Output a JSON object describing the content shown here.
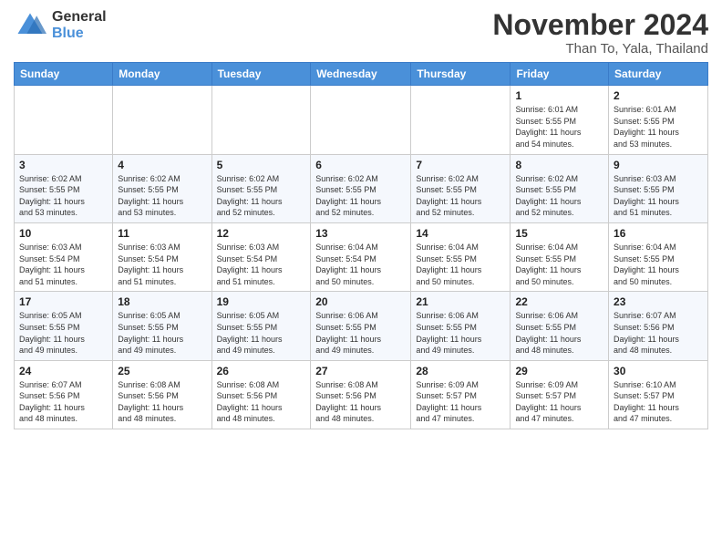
{
  "header": {
    "logo_general": "General",
    "logo_blue": "Blue",
    "month_title": "November 2024",
    "location": "Than To, Yala, Thailand"
  },
  "days_of_week": [
    "Sunday",
    "Monday",
    "Tuesday",
    "Wednesday",
    "Thursday",
    "Friday",
    "Saturday"
  ],
  "weeks": [
    [
      {
        "day": "",
        "info": ""
      },
      {
        "day": "",
        "info": ""
      },
      {
        "day": "",
        "info": ""
      },
      {
        "day": "",
        "info": ""
      },
      {
        "day": "",
        "info": ""
      },
      {
        "day": "1",
        "info": "Sunrise: 6:01 AM\nSunset: 5:55 PM\nDaylight: 11 hours\nand 54 minutes."
      },
      {
        "day": "2",
        "info": "Sunrise: 6:01 AM\nSunset: 5:55 PM\nDaylight: 11 hours\nand 53 minutes."
      }
    ],
    [
      {
        "day": "3",
        "info": "Sunrise: 6:02 AM\nSunset: 5:55 PM\nDaylight: 11 hours\nand 53 minutes."
      },
      {
        "day": "4",
        "info": "Sunrise: 6:02 AM\nSunset: 5:55 PM\nDaylight: 11 hours\nand 53 minutes."
      },
      {
        "day": "5",
        "info": "Sunrise: 6:02 AM\nSunset: 5:55 PM\nDaylight: 11 hours\nand 52 minutes."
      },
      {
        "day": "6",
        "info": "Sunrise: 6:02 AM\nSunset: 5:55 PM\nDaylight: 11 hours\nand 52 minutes."
      },
      {
        "day": "7",
        "info": "Sunrise: 6:02 AM\nSunset: 5:55 PM\nDaylight: 11 hours\nand 52 minutes."
      },
      {
        "day": "8",
        "info": "Sunrise: 6:02 AM\nSunset: 5:55 PM\nDaylight: 11 hours\nand 52 minutes."
      },
      {
        "day": "9",
        "info": "Sunrise: 6:03 AM\nSunset: 5:55 PM\nDaylight: 11 hours\nand 51 minutes."
      }
    ],
    [
      {
        "day": "10",
        "info": "Sunrise: 6:03 AM\nSunset: 5:54 PM\nDaylight: 11 hours\nand 51 minutes."
      },
      {
        "day": "11",
        "info": "Sunrise: 6:03 AM\nSunset: 5:54 PM\nDaylight: 11 hours\nand 51 minutes."
      },
      {
        "day": "12",
        "info": "Sunrise: 6:03 AM\nSunset: 5:54 PM\nDaylight: 11 hours\nand 51 minutes."
      },
      {
        "day": "13",
        "info": "Sunrise: 6:04 AM\nSunset: 5:54 PM\nDaylight: 11 hours\nand 50 minutes."
      },
      {
        "day": "14",
        "info": "Sunrise: 6:04 AM\nSunset: 5:55 PM\nDaylight: 11 hours\nand 50 minutes."
      },
      {
        "day": "15",
        "info": "Sunrise: 6:04 AM\nSunset: 5:55 PM\nDaylight: 11 hours\nand 50 minutes."
      },
      {
        "day": "16",
        "info": "Sunrise: 6:04 AM\nSunset: 5:55 PM\nDaylight: 11 hours\nand 50 minutes."
      }
    ],
    [
      {
        "day": "17",
        "info": "Sunrise: 6:05 AM\nSunset: 5:55 PM\nDaylight: 11 hours\nand 49 minutes."
      },
      {
        "day": "18",
        "info": "Sunrise: 6:05 AM\nSunset: 5:55 PM\nDaylight: 11 hours\nand 49 minutes."
      },
      {
        "day": "19",
        "info": "Sunrise: 6:05 AM\nSunset: 5:55 PM\nDaylight: 11 hours\nand 49 minutes."
      },
      {
        "day": "20",
        "info": "Sunrise: 6:06 AM\nSunset: 5:55 PM\nDaylight: 11 hours\nand 49 minutes."
      },
      {
        "day": "21",
        "info": "Sunrise: 6:06 AM\nSunset: 5:55 PM\nDaylight: 11 hours\nand 49 minutes."
      },
      {
        "day": "22",
        "info": "Sunrise: 6:06 AM\nSunset: 5:55 PM\nDaylight: 11 hours\nand 48 minutes."
      },
      {
        "day": "23",
        "info": "Sunrise: 6:07 AM\nSunset: 5:56 PM\nDaylight: 11 hours\nand 48 minutes."
      }
    ],
    [
      {
        "day": "24",
        "info": "Sunrise: 6:07 AM\nSunset: 5:56 PM\nDaylight: 11 hours\nand 48 minutes."
      },
      {
        "day": "25",
        "info": "Sunrise: 6:08 AM\nSunset: 5:56 PM\nDaylight: 11 hours\nand 48 minutes."
      },
      {
        "day": "26",
        "info": "Sunrise: 6:08 AM\nSunset: 5:56 PM\nDaylight: 11 hours\nand 48 minutes."
      },
      {
        "day": "27",
        "info": "Sunrise: 6:08 AM\nSunset: 5:56 PM\nDaylight: 11 hours\nand 48 minutes."
      },
      {
        "day": "28",
        "info": "Sunrise: 6:09 AM\nSunset: 5:57 PM\nDaylight: 11 hours\nand 47 minutes."
      },
      {
        "day": "29",
        "info": "Sunrise: 6:09 AM\nSunset: 5:57 PM\nDaylight: 11 hours\nand 47 minutes."
      },
      {
        "day": "30",
        "info": "Sunrise: 6:10 AM\nSunset: 5:57 PM\nDaylight: 11 hours\nand 47 minutes."
      }
    ]
  ]
}
